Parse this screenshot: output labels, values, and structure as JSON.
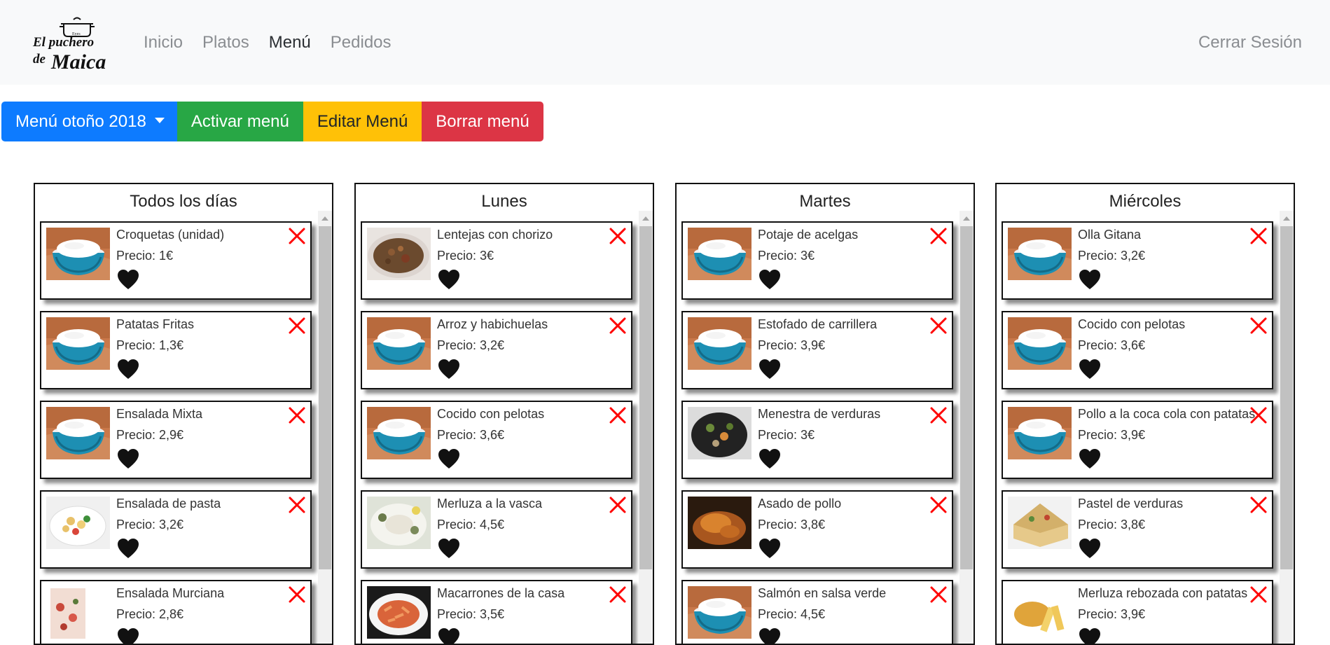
{
  "brand": {
    "logo_line1": "El puchero",
    "logo_line2a": "de",
    "logo_line2b": "Maica"
  },
  "nav": {
    "items": [
      {
        "label": "Inicio",
        "active": false
      },
      {
        "label": "Platos",
        "active": false
      },
      {
        "label": "Menú",
        "active": true
      },
      {
        "label": "Pedidos",
        "active": false
      }
    ],
    "logout_label": "Cerrar Sesión"
  },
  "toolbar": {
    "menu_select_label": "Menú otoño 2018",
    "activate_label": "Activar menú",
    "edit_label": "Editar Menú",
    "delete_label": "Borrar menú"
  },
  "colors": {
    "primary": "#0d7bff",
    "success": "#28a745",
    "warning": "#ffc107",
    "danger": "#dc3545",
    "remove_icon": "#ff0000"
  },
  "icons": {
    "favorite": "heart-icon",
    "remove": "close-icon",
    "dropdown": "caret-down-icon"
  },
  "columns": [
    {
      "title": "Todos los días",
      "dishes": [
        {
          "name": "Croquetas (unidad)",
          "price": "Precio: 1€",
          "image": "rice"
        },
        {
          "name": "Patatas Fritas",
          "price": "Precio: 1,3€",
          "image": "rice"
        },
        {
          "name": "Ensalada Mixta",
          "price": "Precio: 2,9€",
          "image": "rice"
        },
        {
          "name": "Ensalada de pasta",
          "price": "Precio: 3,2€",
          "image": "pasta-salad"
        },
        {
          "name": "Ensalada Murciana",
          "price": "Precio: 2,8€",
          "image": "murciana"
        }
      ]
    },
    {
      "title": "Lunes",
      "dishes": [
        {
          "name": "Lentejas con chorizo",
          "price": "Precio: 3€",
          "image": "lentils"
        },
        {
          "name": "Arroz y habichuelas",
          "price": "Precio: 3,2€",
          "image": "rice"
        },
        {
          "name": "Cocido con pelotas",
          "price": "Precio: 3,6€",
          "image": "rice"
        },
        {
          "name": "Merluza a la vasca",
          "price": "Precio: 4,5€",
          "image": "merluza"
        },
        {
          "name": "Macarrones de la casa",
          "price": "Precio: 3,5€",
          "image": "macarrones"
        }
      ]
    },
    {
      "title": "Martes",
      "dishes": [
        {
          "name": "Potaje de acelgas",
          "price": "Precio: 3€",
          "image": "rice"
        },
        {
          "name": "Estofado de carrillera",
          "price": "Precio: 3,9€",
          "image": "rice"
        },
        {
          "name": "Menestra de verduras",
          "price": "Precio: 3€",
          "image": "menestra"
        },
        {
          "name": "Asado de pollo",
          "price": "Precio: 3,8€",
          "image": "pollo"
        },
        {
          "name": "Salmón en salsa verde",
          "price": "Precio: 4,5€",
          "image": "rice"
        }
      ]
    },
    {
      "title": "Miércoles",
      "dishes": [
        {
          "name": "Olla Gitana",
          "price": "Precio: 3,2€",
          "image": "rice"
        },
        {
          "name": "Cocido con pelotas",
          "price": "Precio: 3,6€",
          "image": "rice"
        },
        {
          "name": "Pollo a la coca cola con patatas",
          "price": "Precio: 3,9€",
          "image": "rice"
        },
        {
          "name": "Pastel de verduras",
          "price": "Precio: 3,8€",
          "image": "pastel"
        },
        {
          "name": "Merluza rebozada con patatas",
          "price": "Precio: 3,9€",
          "image": "rebozada"
        }
      ]
    }
  ]
}
